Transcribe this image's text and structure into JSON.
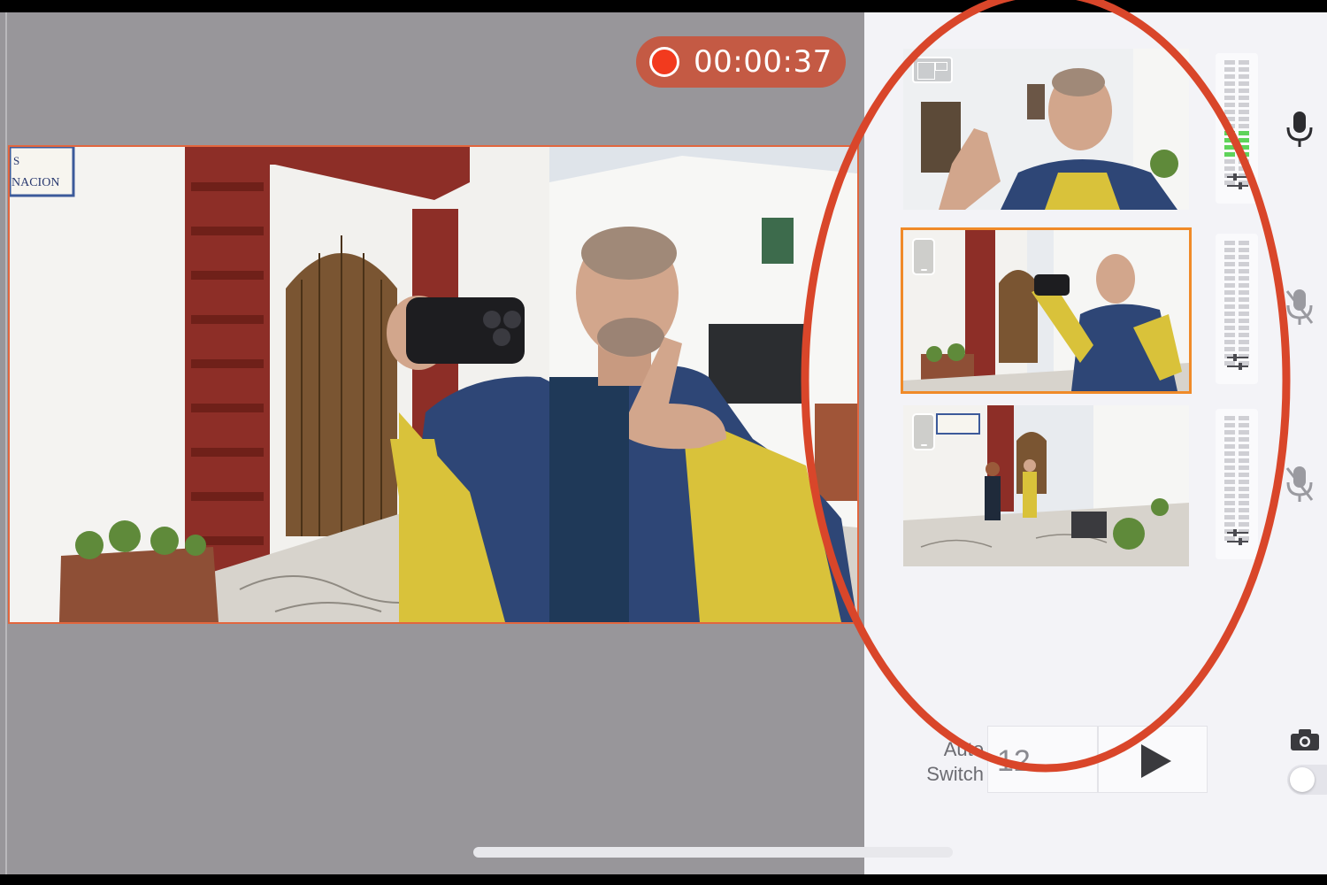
{
  "recording": {
    "timer": "00:00:37",
    "state": "recording",
    "accent_color": "#f23a1e"
  },
  "main_preview": {
    "description_icon": "live-camera-feed",
    "border_color": "#e2663e",
    "sign_text_1": "S",
    "sign_text_2": "NACION"
  },
  "cameras": [
    {
      "badge_icon": "picture-in-picture-icon",
      "selected": false,
      "mic": "mic-on-icon",
      "meter_green_rows": 4
    },
    {
      "badge_icon": "phone-icon",
      "selected": true,
      "mic": "mic-muted-icon",
      "meter_green_rows": 0
    },
    {
      "badge_icon": "phone-icon",
      "selected": false,
      "mic": "mic-muted-icon",
      "meter_green_rows": 0
    }
  ],
  "auto_switch": {
    "label_line1": "Auto",
    "label_line2": "Switch",
    "interval": "12"
  },
  "controls": {
    "play_icon": "play-icon",
    "snapshot_icon": "camera-icon",
    "toggle_state": "off"
  },
  "highlight_color": "#d9462a"
}
